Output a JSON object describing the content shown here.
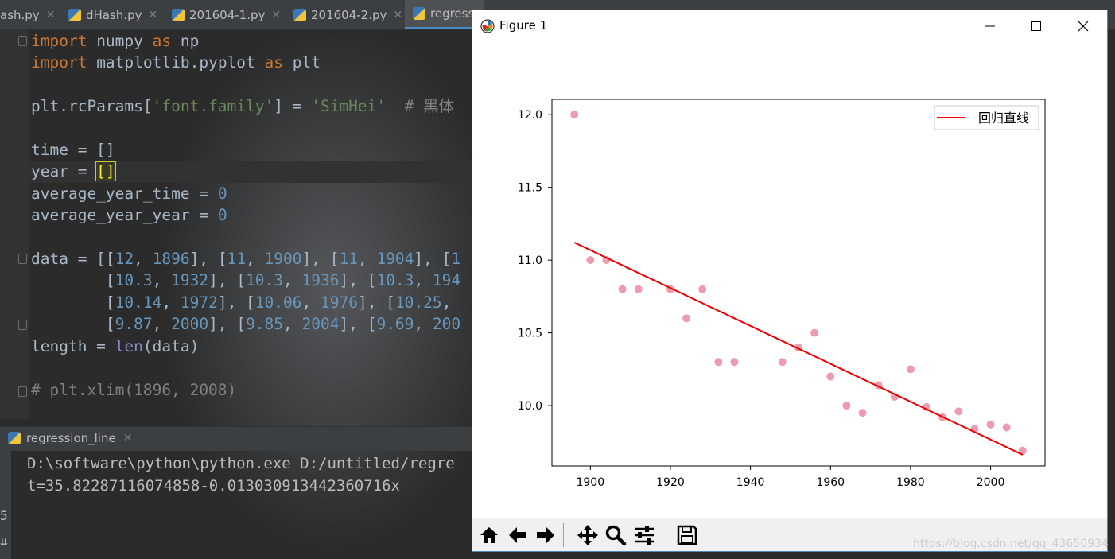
{
  "ide": {
    "tabs": [
      {
        "label": "ash.py"
      },
      {
        "label": "dHash.py"
      },
      {
        "label": "201604-1.py"
      },
      {
        "label": "201604-2.py"
      },
      {
        "label": "regress"
      }
    ],
    "run_tab": {
      "label": "regression_line"
    },
    "console_lines": [
      "D:\\software\\python\\python.exe D:/untitled/regre",
      "t=35.82287116074858-0.013030913442360716x"
    ],
    "gutter_marks": [
      "5",
      "⇊"
    ]
  },
  "figure": {
    "window_title": "Figure 1",
    "window_controls": {
      "minimize": "—",
      "maximize": "☐",
      "close": "✕"
    }
  },
  "chart_data": {
    "type": "scatter",
    "x": [
      1896,
      1900,
      1904,
      1908,
      1912,
      1920,
      1924,
      1928,
      1932,
      1936,
      1948,
      1952,
      1956,
      1960,
      1964,
      1968,
      1972,
      1976,
      1980,
      1984,
      1988,
      1992,
      1996,
      2000,
      2004,
      2008
    ],
    "y": [
      12,
      11,
      11,
      10.8,
      10.8,
      10.8,
      10.6,
      10.8,
      10.3,
      10.3,
      10.3,
      10.4,
      10.5,
      10.2,
      10.0,
      9.95,
      10.14,
      10.06,
      10.25,
      9.99,
      9.92,
      9.96,
      9.84,
      9.87,
      9.85,
      9.69
    ],
    "series": [
      {
        "kind": "scatter",
        "color": "#e8839b"
      },
      {
        "name": "回归直线",
        "kind": "line",
        "color": "#ee0000",
        "x": [
          1896,
          2008
        ],
        "y": [
          11.121,
          9.662
        ]
      }
    ],
    "xticks": [
      "1900",
      "1920",
      "1940",
      "1960",
      "1980",
      "2000"
    ],
    "yticks": [
      "12.0",
      "11.5",
      "11.0",
      "10.5",
      "10.0"
    ],
    "xlim": [
      1890.4,
      2013.6
    ],
    "ylim": [
      9.585,
      12.105
    ],
    "grid": false,
    "legend_position": "upper right"
  }
}
